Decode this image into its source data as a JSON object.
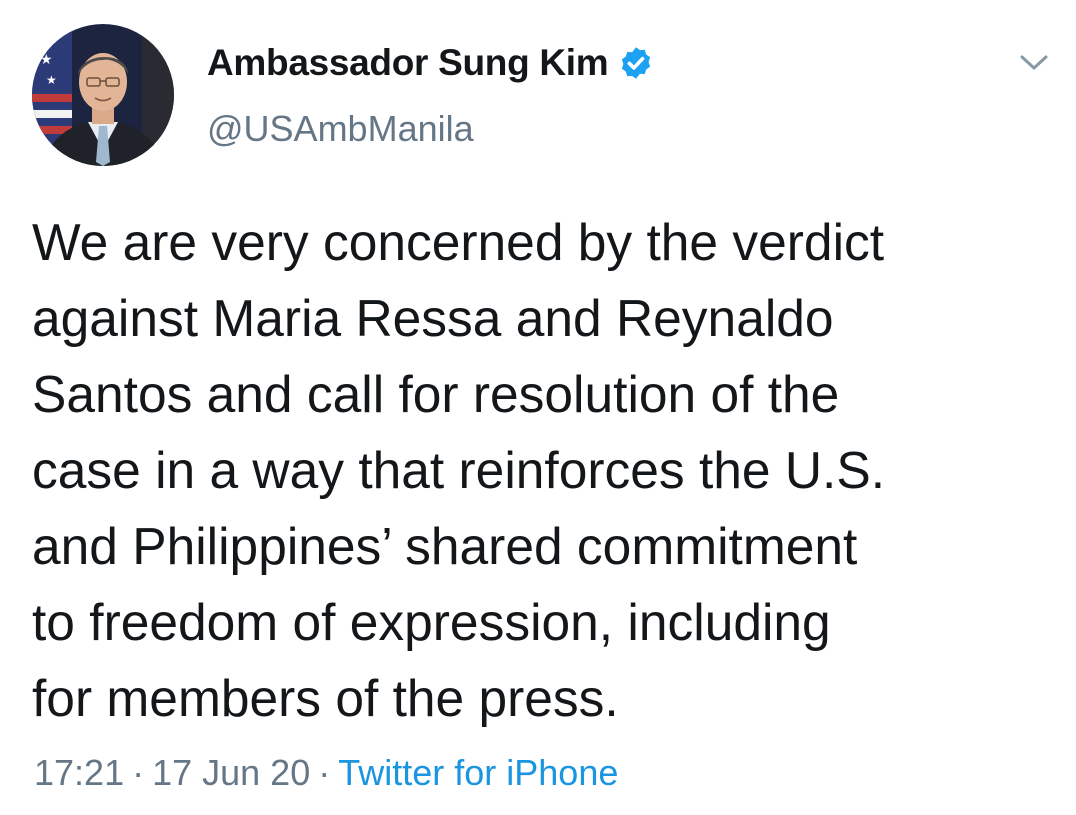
{
  "author": {
    "display_name": "Ambassador Sung Kim",
    "handle": "@USAmbManila",
    "verified": true
  },
  "tweet": {
    "text": "We are very concerned by the verdict\nagainst Maria Ressa and Reynaldo\nSantos and call for resolution of the\ncase in a way that reinforces the U.S.\nand Philippines’ shared commitment\nto freedom of expression, including\nfor members of the press."
  },
  "meta": {
    "time": "17:21",
    "separator": "·",
    "date": "17 Jun 20",
    "source": "Twitter for iPhone"
  },
  "icons": {
    "verified": "verified-badge-icon",
    "menu": "chevron-down-icon"
  },
  "colors": {
    "text": "#14171a",
    "secondary": "#657786",
    "link": "#1b95e0",
    "verified": "#1da1f2"
  }
}
